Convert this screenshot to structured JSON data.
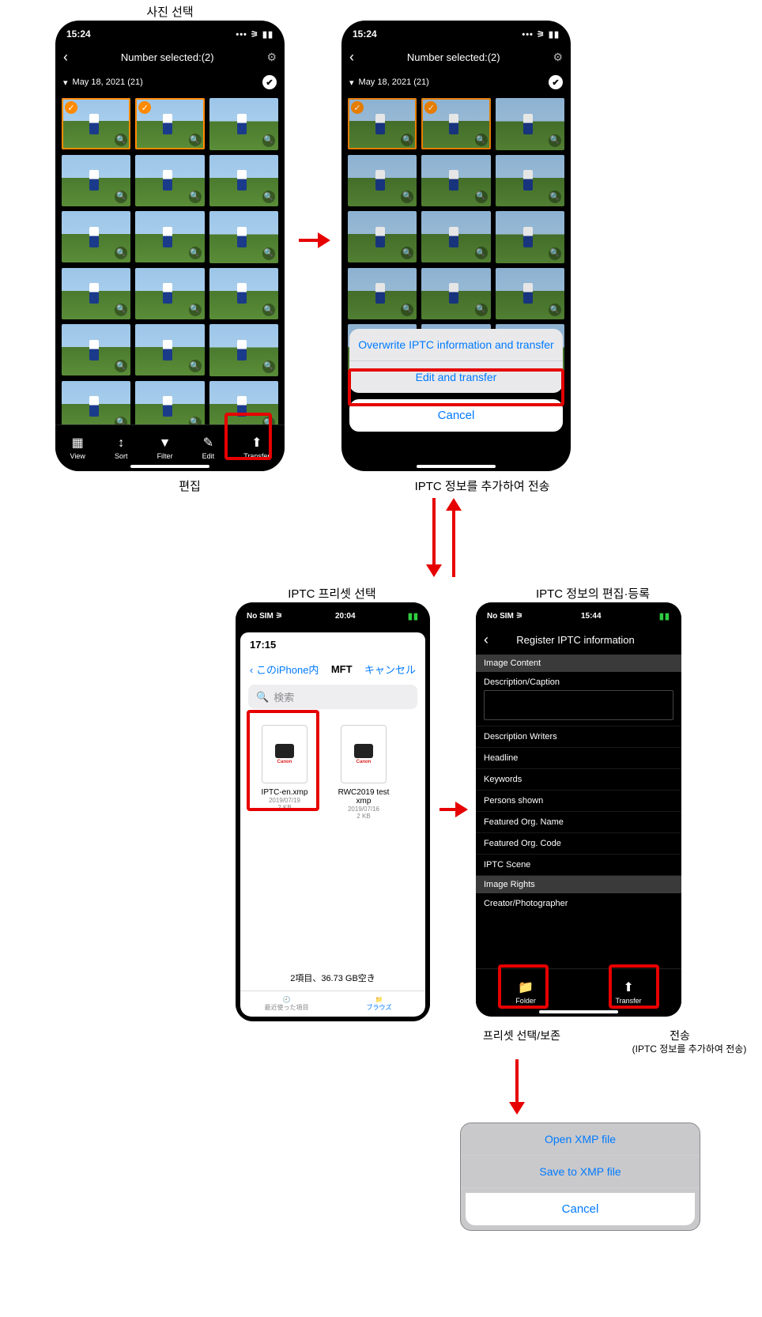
{
  "labels": {
    "top1": "사진 선택",
    "under1": "편집",
    "under2": "IPTC 정보를 추가하여 전송",
    "top3": "IPTC 프리셋 선택",
    "top4": "IPTC 정보의 편집·등록",
    "under4a": "프리셋 선택/보존",
    "under4b": "전송",
    "under4b_sub": "(IPTC 정보를 추가하여 전송)"
  },
  "status": {
    "time_a": "15:24",
    "time_b": "20:04",
    "time_b_inner": "17:15",
    "time_c": "15:44",
    "nosim": "No SIM",
    "batt": "▰▰▰"
  },
  "nav": {
    "selected_title": "Number selected:(2)",
    "date_group": "May 18, 2021 (21)"
  },
  "toolbar": {
    "view": "View",
    "sort": "Sort",
    "filter": "Filter",
    "edit": "Edit",
    "transfer": "Transfer"
  },
  "sheet_edit": {
    "opt1": "Overwrite IPTC information and transfer",
    "opt2": "Edit and transfer",
    "cancel": "Cancel"
  },
  "picker": {
    "back": "このiPhone内",
    "title": "MFT",
    "cancel": "キャンセル",
    "search_ph": "検索",
    "files": [
      {
        "name": "IPTC-en.xmp",
        "date": "2019/07/19",
        "size": "2 KB"
      },
      {
        "name": "RWC2019 test xmp",
        "date": "2019/07/16",
        "size": "2 KB"
      }
    ],
    "footer": "2項目、36.73 GB空き",
    "tab_recent": "最近使った項目",
    "tab_browse": "ブラウズ"
  },
  "register": {
    "title": "Register IPTC information",
    "sections": {
      "content": "Image Content",
      "rights": "Image Rights"
    },
    "fields": {
      "desc": "Description/Caption",
      "writers": "Description Writers",
      "headline": "Headline",
      "keywords": "Keywords",
      "persons": "Persons shown",
      "orgname": "Featured Org. Name",
      "orgcode": "Featured Org. Code",
      "scene": "IPTC Scene",
      "creator": "Creator/Photographer"
    },
    "tb_folder": "Folder",
    "tb_transfer": "Transfer"
  },
  "xmp_sheet": {
    "open": "Open XMP file",
    "save": "Save to XMP file",
    "cancel": "Cancel"
  }
}
